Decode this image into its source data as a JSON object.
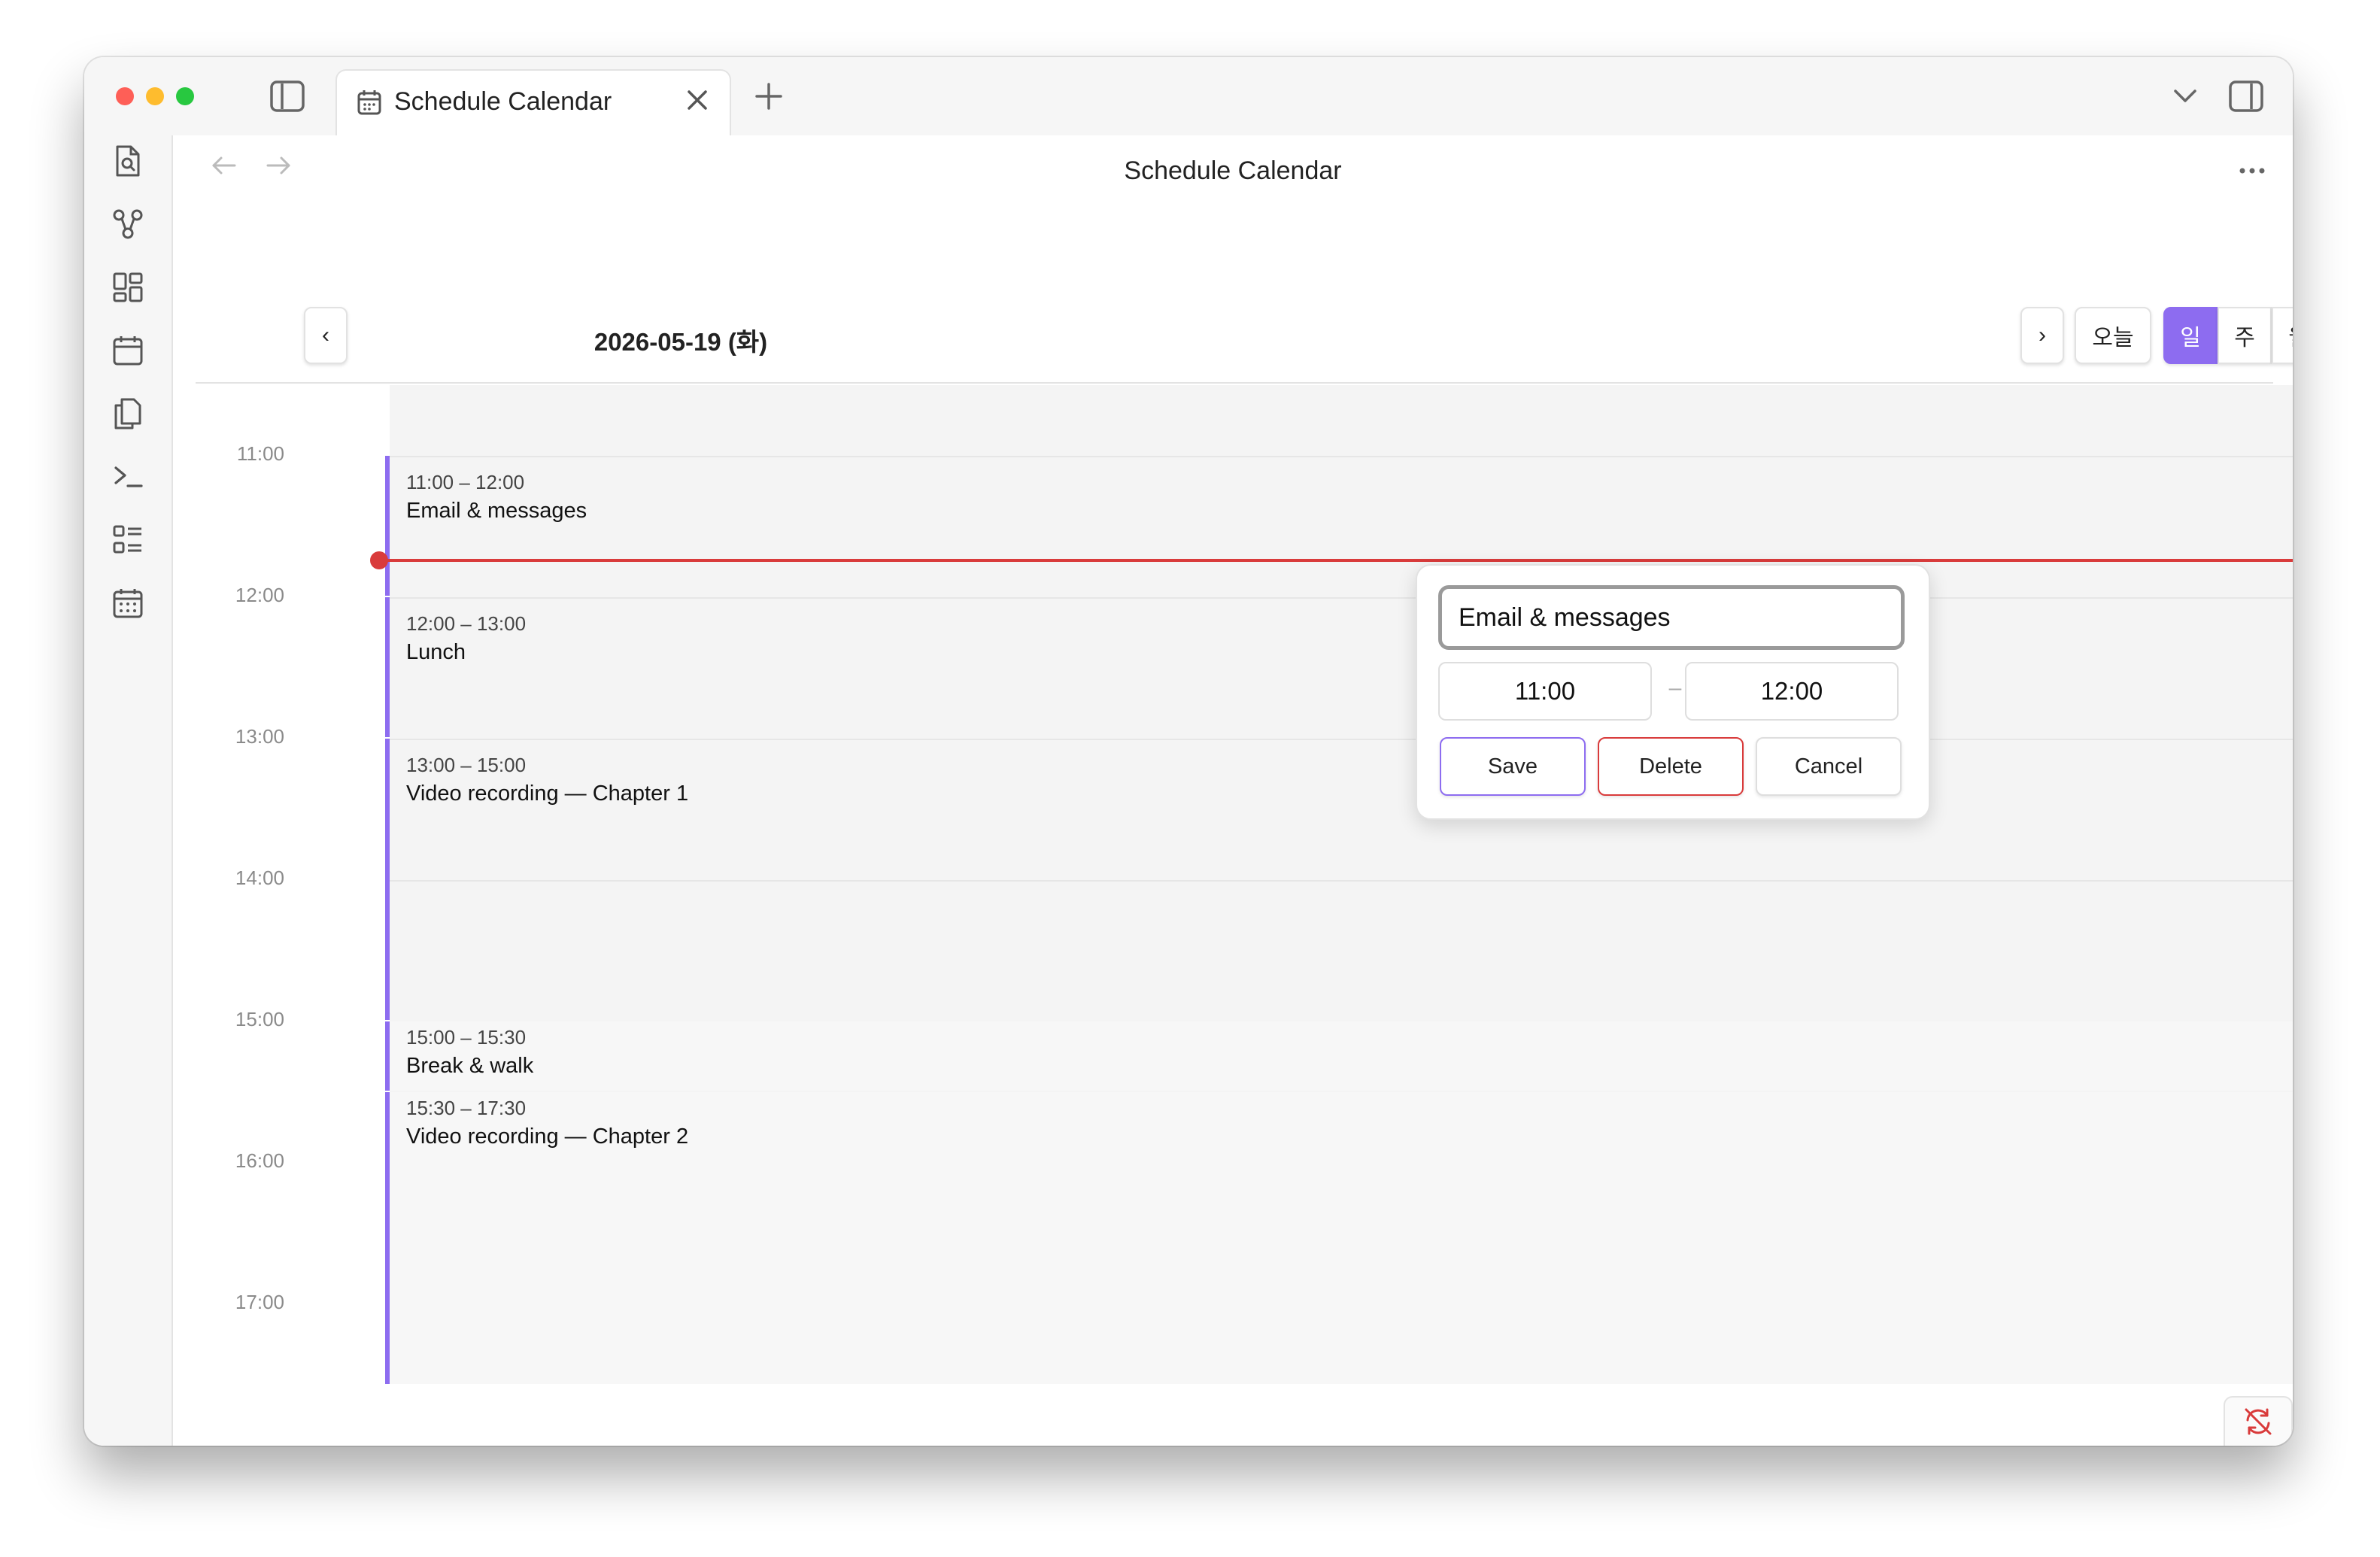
{
  "window": {
    "tab_title": "Schedule Calendar",
    "view_title": "Schedule Calendar"
  },
  "calendar": {
    "date_title": "2026-05-19 (화)",
    "prev_label": "‹",
    "next_label": "›",
    "today_label": "오늘",
    "views": [
      {
        "label": "일",
        "active": true
      },
      {
        "label": "주",
        "active": false
      },
      {
        "label": "월",
        "active": false
      }
    ],
    "hours": [
      "11:00",
      "12:00",
      "13:00",
      "14:00",
      "15:00",
      "16:00",
      "17:00"
    ],
    "current_time": "11:30",
    "events": [
      {
        "time": "11:00 – 12:00",
        "title": "Email & messages"
      },
      {
        "time": "12:00 – 13:00",
        "title": "Lunch"
      },
      {
        "time": "13:00 – 15:00",
        "title": "Video recording — Chapter 1"
      },
      {
        "time": "15:00 – 15:30",
        "title": "Break & walk"
      },
      {
        "time": "15:30 – 17:30",
        "title": "Video recording — Chapter 2"
      }
    ]
  },
  "editor": {
    "title_value": "Email & messages",
    "start_value": "11:00",
    "end_value": "12:00",
    "dash": "–",
    "save_label": "Save",
    "delete_label": "Delete",
    "cancel_label": "Cancel"
  },
  "colors": {
    "accent": "#8d6cf0",
    "now_line": "#d93b3b"
  },
  "icons": {
    "sidebar": [
      "file-search-icon",
      "graph-icon",
      "dashboard-icon",
      "calendar-icon",
      "copy-icon",
      "terminal-icon",
      "list-icon",
      "calendar-grid-icon"
    ]
  }
}
